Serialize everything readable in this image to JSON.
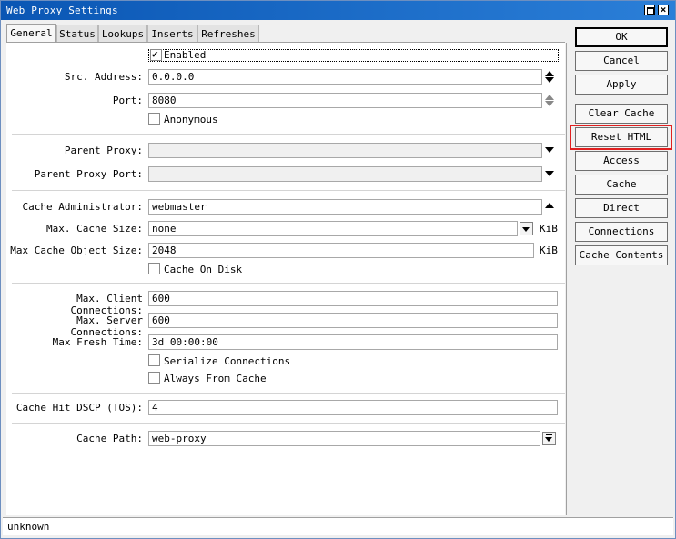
{
  "window": {
    "title": "Web Proxy Settings",
    "max_symbol": "",
    "close_symbol": "×"
  },
  "tabs": [
    {
      "label": "General",
      "active": true
    },
    {
      "label": "Status"
    },
    {
      "label": "Lookups"
    },
    {
      "label": "Inserts"
    },
    {
      "label": "Refreshes"
    }
  ],
  "general": {
    "enabled": {
      "label": "Enabled",
      "checked": true
    },
    "src_address": {
      "label": "Src. Address:",
      "value": "0.0.0.0"
    },
    "port": {
      "label": "Port:",
      "value": "8080"
    },
    "anonymous": {
      "label": "Anonymous",
      "checked": false
    },
    "parent_proxy": {
      "label": "Parent Proxy:",
      "value": ""
    },
    "parent_proxy_port": {
      "label": "Parent Proxy Port:",
      "value": ""
    },
    "cache_administrator": {
      "label": "Cache Administrator:",
      "value": "webmaster"
    },
    "max_cache_size": {
      "label": "Max. Cache Size:",
      "value": "none",
      "unit": "KiB"
    },
    "max_cache_object_size": {
      "label": "Max Cache Object Size:",
      "value": "2048",
      "unit": "KiB"
    },
    "cache_on_disk": {
      "label": "Cache On Disk",
      "checked": false
    },
    "max_client_connections": {
      "label": "Max. Client Connections:",
      "value": "600"
    },
    "max_server_connections": {
      "label": "Max. Server Connections:",
      "value": "600"
    },
    "max_fresh_time": {
      "label": "Max Fresh Time:",
      "value": "3d 00:00:00"
    },
    "serialize_connections": {
      "label": "Serialize Connections",
      "checked": false
    },
    "always_from_cache": {
      "label": "Always From Cache",
      "checked": false
    },
    "cache_hit_dscp": {
      "label": "Cache Hit DSCP (TOS):",
      "value": "4"
    },
    "cache_path": {
      "label": "Cache Path:",
      "value": "web-proxy"
    }
  },
  "buttons": {
    "ok": "OK",
    "cancel": "Cancel",
    "apply": "Apply",
    "clear_cache": "Clear Cache",
    "reset_html": "Reset HTML",
    "access": "Access",
    "cache": "Cache",
    "direct": "Direct",
    "connections": "Connections",
    "cache_contents": "Cache Contents"
  },
  "status": {
    "text": "unknown"
  },
  "colors": {
    "titlebar": "#0b65c2",
    "highlight": "#e02020"
  }
}
